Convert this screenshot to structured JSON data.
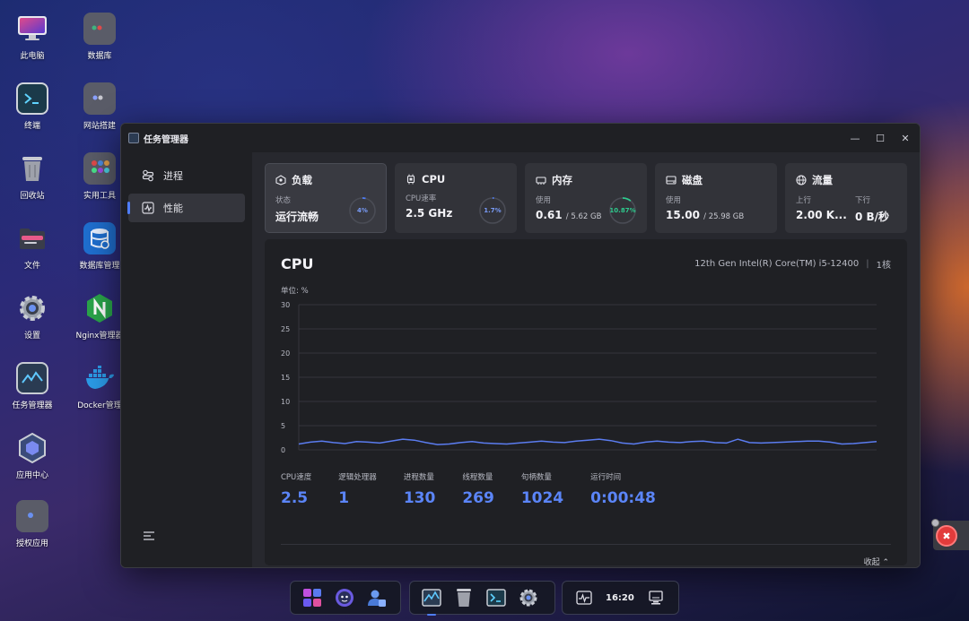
{
  "desktop": {
    "icons": [
      {
        "label": "此电脑"
      },
      {
        "label": "数据库"
      },
      {
        "label": "终端"
      },
      {
        "label": "网站搭建"
      },
      {
        "label": "回收站"
      },
      {
        "label": "实用工具"
      },
      {
        "label": "文件"
      },
      {
        "label": "数据库管理"
      },
      {
        "label": "设置"
      },
      {
        "label": "Nginx管理器"
      },
      {
        "label": "任务管理器"
      },
      {
        "label": "Docker管理"
      },
      {
        "label": "应用中心"
      },
      {
        "label": "授权应用"
      }
    ]
  },
  "window": {
    "title": "任务管理器",
    "controls": {
      "minimize": "—",
      "maximize": "☐",
      "close": "✕"
    }
  },
  "sidebar": {
    "items": [
      {
        "label": "进程",
        "icon": "process-icon"
      },
      {
        "label": "性能",
        "icon": "performance-icon",
        "active": true
      }
    ]
  },
  "cards": {
    "load": {
      "title": "负载",
      "sub": "状态",
      "value": "运行流畅",
      "ring": "4%",
      "ring_value": 0.04,
      "ring_color": "#4f7df7"
    },
    "cpu": {
      "title": "CPU",
      "sub": "CPU速率",
      "value": "2.5 GHz",
      "ring": "1.7%",
      "ring_value": 0.017,
      "ring_color": "#4f7df7"
    },
    "memory": {
      "title": "内存",
      "sub": "使用",
      "value": "0.61",
      "value_small": "/ 5.62 GB",
      "ring": "10.87%",
      "ring_value": 0.1087,
      "ring_color": "#2ecb8e"
    },
    "disk": {
      "title": "磁盘",
      "sub": "使用",
      "value": "15.00",
      "value_small": "/ 25.98 GB"
    },
    "network": {
      "title": "流量",
      "sub_up": "上行",
      "sub_down": "下行",
      "value_up": "2.00 K...",
      "value_down": "0 B/秒"
    }
  },
  "panel": {
    "title": "CPU",
    "model": "12th Gen Intel(R) Core(TM) i5-12400",
    "separator": "|",
    "cores": "1核",
    "unit": "单位: %",
    "collapse_label": "收起 ⌃",
    "stats": [
      {
        "label": "CPU速度",
        "value": "2.5"
      },
      {
        "label": "逻辑处理器",
        "value": "1"
      },
      {
        "label": "进程数量",
        "value": "130"
      },
      {
        "label": "线程数量",
        "value": "269"
      },
      {
        "label": "句柄数量",
        "value": "1024"
      },
      {
        "label": "运行时间",
        "value": "0:00:48"
      }
    ]
  },
  "chart_data": {
    "type": "line",
    "title": "CPU",
    "ylabel": "单位: %",
    "ylim": [
      0,
      30
    ],
    "yticks": [
      0,
      5,
      10,
      15,
      20,
      25,
      30
    ],
    "grid": true,
    "series": [
      {
        "color": "#5b7cf0",
        "values": [
          1.2,
          1.6,
          1.8,
          1.5,
          1.3,
          1.7,
          1.6,
          1.4,
          1.8,
          2.2,
          2.0,
          1.5,
          1.1,
          1.2,
          1.5,
          1.7,
          1.4,
          1.3,
          1.2,
          1.4,
          1.6,
          1.8,
          1.6,
          1.5,
          1.8,
          2.0,
          2.2,
          1.9,
          1.4,
          1.2,
          1.6,
          1.8,
          1.6,
          1.5,
          1.7,
          1.8,
          1.5,
          1.4,
          2.2,
          1.5,
          1.4,
          1.5,
          1.6,
          1.7,
          1.8,
          1.8,
          1.6,
          1.2,
          1.3,
          1.5,
          1.7
        ]
      }
    ]
  },
  "taskbar": {
    "clock": "16:20"
  }
}
